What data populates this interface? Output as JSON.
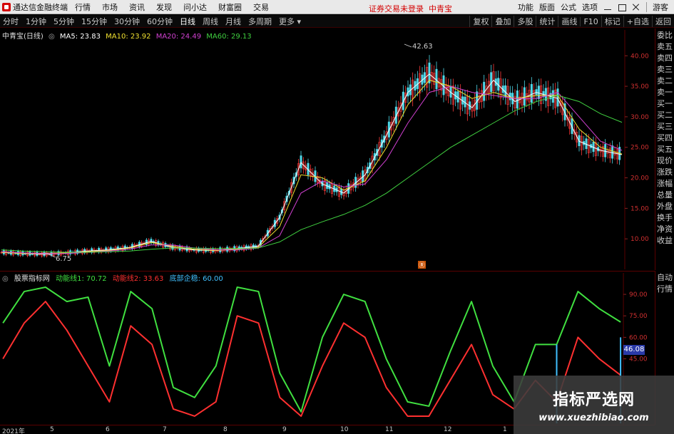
{
  "app": {
    "title": "通达信金融终端",
    "menu": [
      "行情",
      "市场",
      "资讯",
      "发现",
      "问小达",
      "财富圈",
      "交易"
    ],
    "notice": "证券交易未登录",
    "stock_name_top": "中青宝",
    "right_menu": [
      "功能",
      "版面",
      "公式",
      "选项",
      "游客"
    ]
  },
  "toolbar": {
    "periods": [
      "分时",
      "1分钟",
      "5分钟",
      "15分钟",
      "30分钟",
      "60分钟",
      "日线",
      "周线",
      "月线",
      "多周期",
      "更多"
    ],
    "active_period": "日线",
    "right": [
      "复权",
      "叠加",
      "多股",
      "统计",
      "画线",
      "F10",
      "标记",
      "+自选",
      "返回"
    ]
  },
  "main_chart": {
    "title": "中青宝(日线)",
    "ma": [
      {
        "label": "MA5: 23.83",
        "color": "#ffffff"
      },
      {
        "label": "MA10: 23.92",
        "color": "#f0e030"
      },
      {
        "label": "MA20: 24.49",
        "color": "#d040d0"
      },
      {
        "label": "MA60: 29.13",
        "color": "#40d040"
      }
    ],
    "high_label": "42.63",
    "low_label": "6.75",
    "event_marker": "Ⓡ"
  },
  "side_panel": [
    "委比",
    "卖五",
    "卖四",
    "卖三",
    "卖二",
    "卖一",
    "买一",
    "买二",
    "买三",
    "买四",
    "买五",
    "现价",
    "涨跌",
    "涨幅",
    "总量",
    "外盘",
    "换手",
    "净资",
    "收益"
  ],
  "side_panel2": [
    "自动",
    "行情"
  ],
  "sub_chart": {
    "indicator": "股票指标网",
    "lines": [
      {
        "label": "动能线1: 70.72",
        "color": "#40e040"
      },
      {
        "label": "动能线2: 33.63",
        "color": "#ff3030"
      },
      {
        "label": "底部企稳: 60.00",
        "color": "#40c0ff"
      }
    ],
    "current_value": "46.08"
  },
  "date_axis": [
    "2021年",
    "5",
    "6",
    "7",
    "8",
    "9",
    "10",
    "11",
    "12",
    "1"
  ],
  "chart_data": [
    {
      "type": "line",
      "title": "中青宝(日线)",
      "xlabel": "",
      "ylabel": "",
      "ylim": [
        5,
        44
      ],
      "y_ticks": [
        "10.00",
        "15.00",
        "20.00",
        "25.00",
        "30.00",
        "35.00",
        "40.00"
      ],
      "x": [
        0,
        10,
        20,
        30,
        40,
        50,
        60,
        70,
        80,
        90,
        100,
        110,
        120,
        130,
        140,
        150,
        160,
        170,
        180,
        190,
        200,
        210,
        220,
        230,
        240,
        250,
        260,
        270,
        280,
        290
      ],
      "series": [
        {
          "name": "MA5",
          "color": "#ffffff",
          "values": [
            7.8,
            7.6,
            7.5,
            7.7,
            8.0,
            8.2,
            8.6,
            9.6,
            8.6,
            8.2,
            8.1,
            8.4,
            8.8,
            13.5,
            22.5,
            19.0,
            17.5,
            20.5,
            27.0,
            34.0,
            37.0,
            34.0,
            31.5,
            36.0,
            32.5,
            34.0,
            33.0,
            26.0,
            24.5,
            23.8
          ]
        },
        {
          "name": "MA10",
          "color": "#f0e030",
          "values": [
            7.8,
            7.6,
            7.6,
            7.7,
            7.9,
            8.1,
            8.5,
            9.4,
            8.8,
            8.3,
            8.1,
            8.3,
            8.6,
            12.0,
            20.5,
            20.0,
            18.0,
            19.5,
            25.0,
            32.0,
            36.0,
            35.0,
            33.0,
            34.0,
            33.0,
            33.5,
            33.5,
            28.0,
            25.0,
            23.9
          ]
        },
        {
          "name": "MA20",
          "color": "#d040d0",
          "values": [
            7.9,
            7.7,
            7.6,
            7.6,
            7.8,
            8.0,
            8.3,
            9.0,
            9.0,
            8.5,
            8.2,
            8.2,
            8.5,
            10.5,
            17.5,
            19.5,
            18.5,
            19.0,
            23.0,
            29.0,
            34.0,
            35.0,
            34.0,
            33.5,
            33.0,
            33.0,
            34.0,
            30.0,
            26.0,
            24.5
          ]
        },
        {
          "name": "MA60",
          "color": "#40d040",
          "values": [
            8.2,
            8.0,
            7.9,
            7.8,
            7.8,
            7.9,
            8.0,
            8.3,
            8.5,
            8.5,
            8.4,
            8.4,
            8.5,
            9.5,
            11.5,
            12.8,
            14.0,
            15.5,
            17.5,
            20.0,
            22.5,
            25.0,
            27.0,
            29.0,
            31.0,
            32.5,
            33.5,
            32.5,
            30.5,
            29.1
          ]
        }
      ]
    },
    {
      "type": "line",
      "title": "股票指标网",
      "xlabel": "",
      "ylabel": "",
      "ylim": [
        0,
        100
      ],
      "y_ticks": [
        "45.00",
        "60.00",
        "75.00",
        "90.00"
      ],
      "x": [
        0,
        10,
        20,
        30,
        40,
        50,
        60,
        70,
        80,
        90,
        100,
        110,
        120,
        130,
        140,
        150,
        160,
        170,
        180,
        190,
        200,
        210,
        220,
        230,
        240,
        250,
        260,
        270,
        280,
        290
      ],
      "series": [
        {
          "name": "动能线1",
          "color": "#40e040",
          "values": [
            70,
            92,
            95,
            85,
            88,
            40,
            92,
            80,
            25,
            18,
            40,
            95,
            92,
            35,
            8,
            60,
            90,
            85,
            45,
            15,
            12,
            50,
            85,
            40,
            15,
            55,
            55,
            92,
            80,
            70.7
          ]
        },
        {
          "name": "动能线2",
          "color": "#ff3030",
          "values": [
            45,
            70,
            85,
            65,
            40,
            15,
            68,
            55,
            10,
            5,
            15,
            75,
            70,
            18,
            5,
            40,
            70,
            60,
            25,
            5,
            5,
            30,
            55,
            20,
            10,
            30,
            15,
            60,
            45,
            33.6
          ]
        },
        {
          "name": "底部企稳",
          "color": "#40c0ff",
          "values": [
            0,
            0,
            0,
            0,
            0,
            0,
            0,
            0,
            0,
            0,
            0,
            0,
            0,
            0,
            0,
            0,
            0,
            0,
            0,
            0,
            0,
            0,
            0,
            0,
            0,
            0,
            55,
            0,
            0,
            60
          ]
        }
      ]
    }
  ]
}
